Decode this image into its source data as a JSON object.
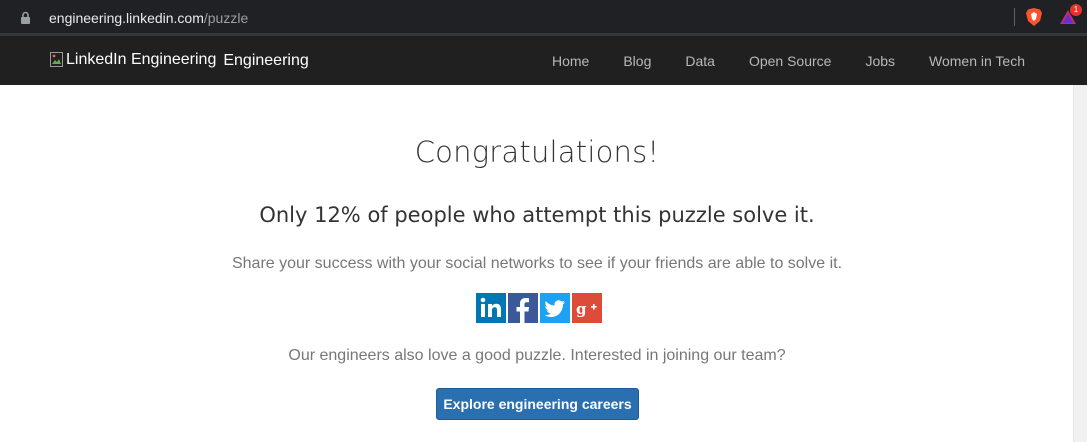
{
  "browser": {
    "url_host": "engineering.linkedin.com",
    "url_path": "/puzzle",
    "rewards_badge": "1"
  },
  "nav": {
    "logo_alt": "LinkedIn Engineering",
    "logo_suffix": "Engineering",
    "links": [
      "Home",
      "Blog",
      "Data",
      "Open Source",
      "Jobs",
      "Women in Tech"
    ]
  },
  "main": {
    "headline": "Congratulations!",
    "subhead": "Only 12% of people who attempt this puzzle solve it.",
    "share_text": "Share your success with your social networks to see if your friends are able to solve it.",
    "social": [
      {
        "name": "linkedin-icon",
        "color": "#0077b5"
      },
      {
        "name": "facebook-icon",
        "color": "#3b5998"
      },
      {
        "name": "twitter-icon",
        "color": "#1da1f2"
      },
      {
        "name": "google-plus-icon",
        "color": "#dd4b39"
      }
    ],
    "team_text": "Our engineers also love a good puzzle. Interested in joining our team?",
    "cta_label": "Explore engineering careers"
  },
  "colors": {
    "nav_bg": "#202020",
    "cta_bg": "#2a6fb0"
  }
}
